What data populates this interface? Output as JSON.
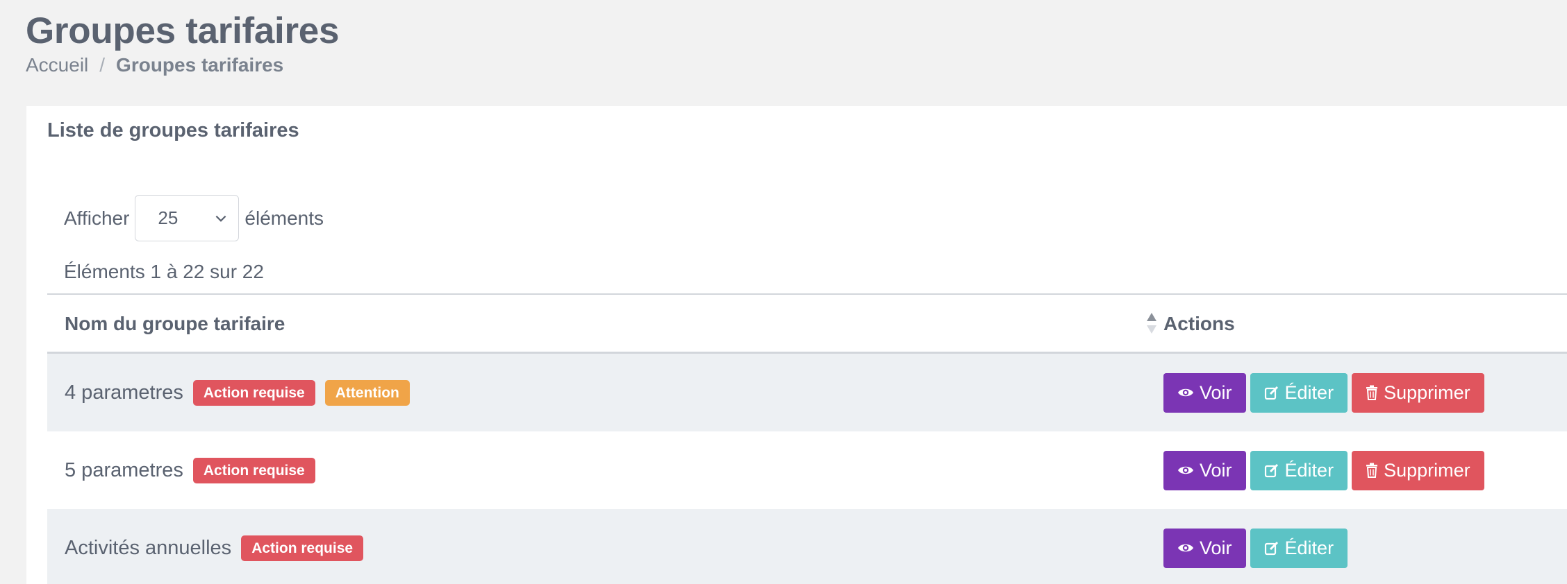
{
  "header": {
    "title": "Groupes tarifaires",
    "breadcrumb": {
      "home": "Accueil",
      "separator": "/",
      "current": "Groupes tarifaires"
    }
  },
  "card": {
    "title": "Liste de groupes tarifaires",
    "length": {
      "prefix": "Afficher",
      "value": "25",
      "suffix": "éléments"
    },
    "info": "Éléments 1 à 22 sur 22"
  },
  "table": {
    "columns": {
      "name": "Nom du groupe tarifaire",
      "actions": "Actions"
    },
    "rows": [
      {
        "name": "4 parametres",
        "badges": [
          {
            "label": "Action requise",
            "type": "danger"
          },
          {
            "label": "Attention",
            "type": "warning"
          }
        ],
        "actions": [
          "Voir",
          "Éditer",
          "Supprimer"
        ]
      },
      {
        "name": "5 parametres",
        "badges": [
          {
            "label": "Action requise",
            "type": "danger"
          }
        ],
        "actions": [
          "Voir",
          "Éditer",
          "Supprimer"
        ]
      },
      {
        "name": "Activités annuelles",
        "badges": [
          {
            "label": "Action requise",
            "type": "danger"
          }
        ],
        "actions": [
          "Voir",
          "Éditer"
        ]
      }
    ]
  },
  "colors": {
    "view": "#7b35b4",
    "edit": "#5cc3c5",
    "delete": "#e0555e",
    "warning": "#f0a448"
  },
  "icons": {
    "view": "eye-icon",
    "edit": "edit-icon",
    "delete": "trash-icon",
    "sort": "sort-icon",
    "select": "chevron-down-icon"
  }
}
